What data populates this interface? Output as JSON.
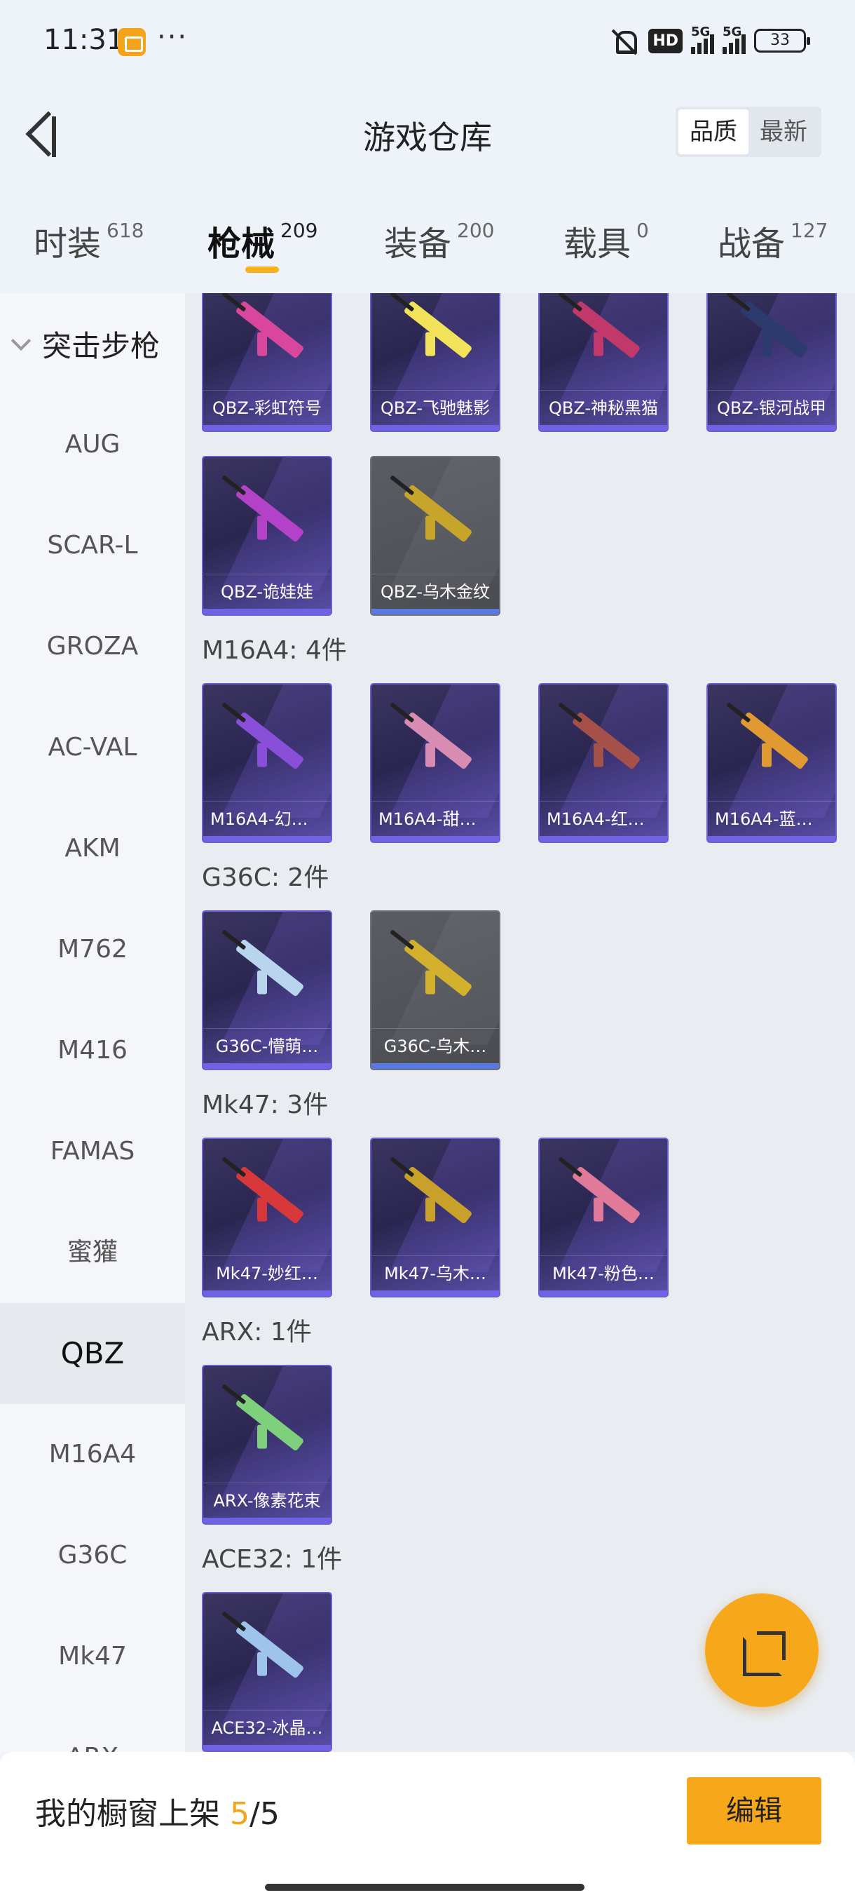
{
  "status": {
    "time": "11:31",
    "dots": "···",
    "hd": "HD",
    "net1": "5G",
    "net2": "5G",
    "battery": "33"
  },
  "header": {
    "title": "游戏仓库",
    "sort_quality": "品质",
    "sort_latest": "最新"
  },
  "tabs": [
    {
      "label": "时装",
      "count": "618"
    },
    {
      "label": "枪械",
      "count": "209"
    },
    {
      "label": "装备",
      "count": "200"
    },
    {
      "label": "载具",
      "count": "0"
    },
    {
      "label": "战备",
      "count": "127"
    }
  ],
  "sidebar": {
    "category": "突击步枪",
    "items": [
      "AUG",
      "SCAR-L",
      "GROZA",
      "AC-VAL",
      "AKM",
      "M762",
      "M416",
      "FAMAS",
      "蜜獾",
      "QBZ",
      "M16A4",
      "G36C",
      "Mk47",
      "ARX"
    ]
  },
  "sections": {
    "qbz": {
      "items": [
        "QBZ-彩虹符号",
        "QBZ-飞驰魅影",
        "QBZ-神秘黑猫",
        "QBZ-银河战甲",
        "QBZ-诡娃娃",
        "QBZ-乌木金纹"
      ]
    },
    "m16a4": {
      "title": "M16A4: 4件",
      "items": [
        "M16A4-幻世…",
        "M16A4-甜心…",
        "M16A4-红色…",
        "M16A4-蓝色…"
      ]
    },
    "g36c": {
      "title": "G36C: 2件",
      "items": [
        "G36C-懵萌…",
        "G36C-乌木…"
      ]
    },
    "mk47": {
      "title": "Mk47: 3件",
      "items": [
        "Mk47-妙红…",
        "Mk47-乌木…",
        "Mk47-粉色…"
      ]
    },
    "arx": {
      "title": "ARX: 1件",
      "items": [
        "ARX-像素花束"
      ]
    },
    "ace32": {
      "title": "ACE32: 1件",
      "items": [
        "ACE32-冰晶…"
      ]
    }
  },
  "bottom": {
    "prefix": "我的橱窗上架 ",
    "count": "5",
    "total": "/5",
    "edit_label": "编辑"
  },
  "colors": {
    "accent": "#f7a81a",
    "card_purple": "#2a2650",
    "card_grey": "#4a4c52"
  },
  "icons": [
    "back-icon",
    "chevron-down-icon",
    "share-icon"
  ]
}
